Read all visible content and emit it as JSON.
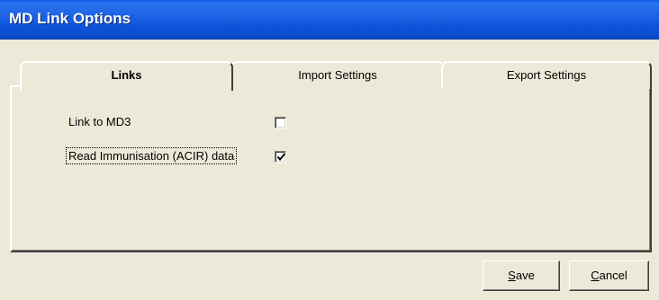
{
  "window": {
    "title": "MD Link Options",
    "titlebar_color": "#0A5BE4",
    "background": "#ECE9D8"
  },
  "tabs": [
    {
      "label": "Links",
      "selected": true
    },
    {
      "label": "Import Settings",
      "selected": false
    },
    {
      "label": "Export Settings",
      "selected": false
    }
  ],
  "links_tab": {
    "options": [
      {
        "label": "Link to MD3",
        "checked": false
      },
      {
        "label": "Read Immunisation (ACIR) data",
        "checked": true,
        "focused": true
      }
    ]
  },
  "buttons": {
    "save": {
      "mnemonic": "S",
      "rest": "ave"
    },
    "cancel": {
      "mnemonic": "C",
      "rest": "ancel"
    }
  }
}
